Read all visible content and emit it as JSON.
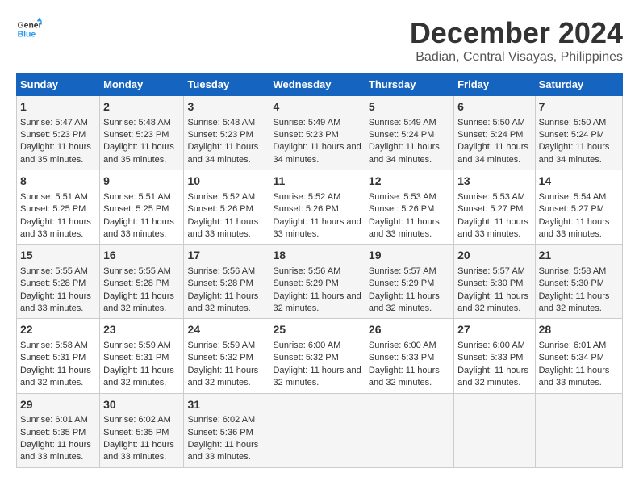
{
  "logo": {
    "line1": "General",
    "line2": "Blue"
  },
  "title": "December 2024",
  "subtitle": "Badian, Central Visayas, Philippines",
  "days": [
    "Sunday",
    "Monday",
    "Tuesday",
    "Wednesday",
    "Thursday",
    "Friday",
    "Saturday"
  ],
  "weeks": [
    [
      {
        "date": "1",
        "sunrise": "Sunrise: 5:47 AM",
        "sunset": "Sunset: 5:23 PM",
        "daylight": "Daylight: 11 hours and 35 minutes."
      },
      {
        "date": "2",
        "sunrise": "Sunrise: 5:48 AM",
        "sunset": "Sunset: 5:23 PM",
        "daylight": "Daylight: 11 hours and 35 minutes."
      },
      {
        "date": "3",
        "sunrise": "Sunrise: 5:48 AM",
        "sunset": "Sunset: 5:23 PM",
        "daylight": "Daylight: 11 hours and 34 minutes."
      },
      {
        "date": "4",
        "sunrise": "Sunrise: 5:49 AM",
        "sunset": "Sunset: 5:23 PM",
        "daylight": "Daylight: 11 hours and 34 minutes."
      },
      {
        "date": "5",
        "sunrise": "Sunrise: 5:49 AM",
        "sunset": "Sunset: 5:24 PM",
        "daylight": "Daylight: 11 hours and 34 minutes."
      },
      {
        "date": "6",
        "sunrise": "Sunrise: 5:50 AM",
        "sunset": "Sunset: 5:24 PM",
        "daylight": "Daylight: 11 hours and 34 minutes."
      },
      {
        "date": "7",
        "sunrise": "Sunrise: 5:50 AM",
        "sunset": "Sunset: 5:24 PM",
        "daylight": "Daylight: 11 hours and 34 minutes."
      }
    ],
    [
      {
        "date": "8",
        "sunrise": "Sunrise: 5:51 AM",
        "sunset": "Sunset: 5:25 PM",
        "daylight": "Daylight: 11 hours and 33 minutes."
      },
      {
        "date": "9",
        "sunrise": "Sunrise: 5:51 AM",
        "sunset": "Sunset: 5:25 PM",
        "daylight": "Daylight: 11 hours and 33 minutes."
      },
      {
        "date": "10",
        "sunrise": "Sunrise: 5:52 AM",
        "sunset": "Sunset: 5:26 PM",
        "daylight": "Daylight: 11 hours and 33 minutes."
      },
      {
        "date": "11",
        "sunrise": "Sunrise: 5:52 AM",
        "sunset": "Sunset: 5:26 PM",
        "daylight": "Daylight: 11 hours and 33 minutes."
      },
      {
        "date": "12",
        "sunrise": "Sunrise: 5:53 AM",
        "sunset": "Sunset: 5:26 PM",
        "daylight": "Daylight: 11 hours and 33 minutes."
      },
      {
        "date": "13",
        "sunrise": "Sunrise: 5:53 AM",
        "sunset": "Sunset: 5:27 PM",
        "daylight": "Daylight: 11 hours and 33 minutes."
      },
      {
        "date": "14",
        "sunrise": "Sunrise: 5:54 AM",
        "sunset": "Sunset: 5:27 PM",
        "daylight": "Daylight: 11 hours and 33 minutes."
      }
    ],
    [
      {
        "date": "15",
        "sunrise": "Sunrise: 5:55 AM",
        "sunset": "Sunset: 5:28 PM",
        "daylight": "Daylight: 11 hours and 33 minutes."
      },
      {
        "date": "16",
        "sunrise": "Sunrise: 5:55 AM",
        "sunset": "Sunset: 5:28 PM",
        "daylight": "Daylight: 11 hours and 32 minutes."
      },
      {
        "date": "17",
        "sunrise": "Sunrise: 5:56 AM",
        "sunset": "Sunset: 5:28 PM",
        "daylight": "Daylight: 11 hours and 32 minutes."
      },
      {
        "date": "18",
        "sunrise": "Sunrise: 5:56 AM",
        "sunset": "Sunset: 5:29 PM",
        "daylight": "Daylight: 11 hours and 32 minutes."
      },
      {
        "date": "19",
        "sunrise": "Sunrise: 5:57 AM",
        "sunset": "Sunset: 5:29 PM",
        "daylight": "Daylight: 11 hours and 32 minutes."
      },
      {
        "date": "20",
        "sunrise": "Sunrise: 5:57 AM",
        "sunset": "Sunset: 5:30 PM",
        "daylight": "Daylight: 11 hours and 32 minutes."
      },
      {
        "date": "21",
        "sunrise": "Sunrise: 5:58 AM",
        "sunset": "Sunset: 5:30 PM",
        "daylight": "Daylight: 11 hours and 32 minutes."
      }
    ],
    [
      {
        "date": "22",
        "sunrise": "Sunrise: 5:58 AM",
        "sunset": "Sunset: 5:31 PM",
        "daylight": "Daylight: 11 hours and 32 minutes."
      },
      {
        "date": "23",
        "sunrise": "Sunrise: 5:59 AM",
        "sunset": "Sunset: 5:31 PM",
        "daylight": "Daylight: 11 hours and 32 minutes."
      },
      {
        "date": "24",
        "sunrise": "Sunrise: 5:59 AM",
        "sunset": "Sunset: 5:32 PM",
        "daylight": "Daylight: 11 hours and 32 minutes."
      },
      {
        "date": "25",
        "sunrise": "Sunrise: 6:00 AM",
        "sunset": "Sunset: 5:32 PM",
        "daylight": "Daylight: 11 hours and 32 minutes."
      },
      {
        "date": "26",
        "sunrise": "Sunrise: 6:00 AM",
        "sunset": "Sunset: 5:33 PM",
        "daylight": "Daylight: 11 hours and 32 minutes."
      },
      {
        "date": "27",
        "sunrise": "Sunrise: 6:00 AM",
        "sunset": "Sunset: 5:33 PM",
        "daylight": "Daylight: 11 hours and 32 minutes."
      },
      {
        "date": "28",
        "sunrise": "Sunrise: 6:01 AM",
        "sunset": "Sunset: 5:34 PM",
        "daylight": "Daylight: 11 hours and 33 minutes."
      }
    ],
    [
      {
        "date": "29",
        "sunrise": "Sunrise: 6:01 AM",
        "sunset": "Sunset: 5:35 PM",
        "daylight": "Daylight: 11 hours and 33 minutes."
      },
      {
        "date": "30",
        "sunrise": "Sunrise: 6:02 AM",
        "sunset": "Sunset: 5:35 PM",
        "daylight": "Daylight: 11 hours and 33 minutes."
      },
      {
        "date": "31",
        "sunrise": "Sunrise: 6:02 AM",
        "sunset": "Sunset: 5:36 PM",
        "daylight": "Daylight: 11 hours and 33 minutes."
      },
      null,
      null,
      null,
      null
    ]
  ]
}
